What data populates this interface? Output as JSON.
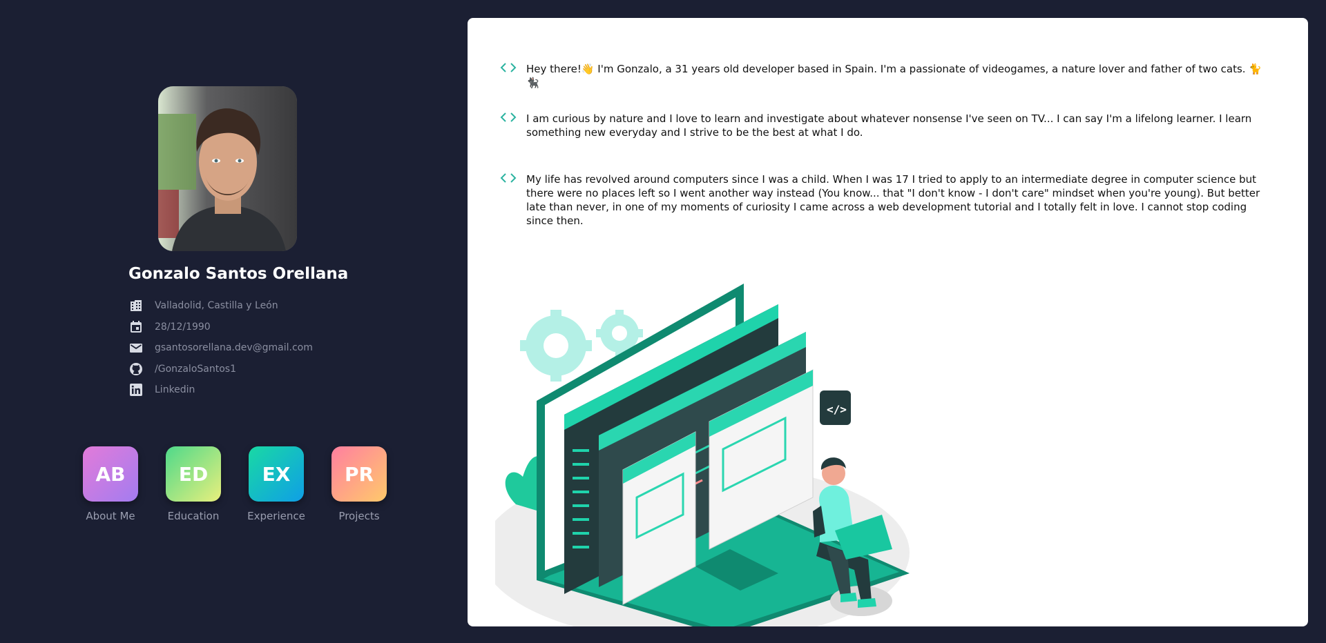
{
  "profile": {
    "name": "Gonzalo Santos Orellana",
    "info": [
      {
        "icon": "building-icon",
        "text": "Valladolid, Castilla y León"
      },
      {
        "icon": "calendar-icon",
        "text": "28/12/1990"
      },
      {
        "icon": "mail-icon",
        "text": "gsantosorellana.dev@gmail.com"
      },
      {
        "icon": "github-icon",
        "text": "/GonzaloSantos1"
      },
      {
        "icon": "linkedin-icon",
        "text": "Linkedin"
      }
    ]
  },
  "nav": [
    {
      "abbr": "AB",
      "label": "About Me",
      "gradient": [
        "#e27bd9",
        "#a37cf0"
      ]
    },
    {
      "abbr": "ED",
      "label": "Education",
      "gradient": [
        "#4fd98a",
        "#e8ef7d"
      ]
    },
    {
      "abbr": "EX",
      "label": "Experience",
      "gradient": [
        "#19d9a4",
        "#0f9fe6"
      ]
    },
    {
      "abbr": "PR",
      "label": "Projects",
      "gradient": [
        "#ff7fa0",
        "#ffc96b"
      ]
    }
  ],
  "about": {
    "paragraphs": [
      "Hey there!👋 I'm Gonzalo, a 31 years old developer based in Spain. I'm a passionate of videogames, a nature lover and father of two cats. 🐈🐈‍⬛",
      "I am curious by nature and I love to learn and investigate about whatever nonsense I've seen on TV... I can say I'm a lifelong learner. I learn something new everyday and I strive to be the best at what I do.",
      "My life has revolved around computers since I was a child. When I was 17 I tried to apply to an intermediate degree in computer science but there were no places left so I went another way instead (You know... that \"I don't know - I don't care\" mindset when you're young). But better late than never, in one of my moments of curiosity I came across a web development tutorial and I totally felt in love. I cannot stop coding since then."
    ]
  },
  "colors": {
    "background": "#1b1f33",
    "accent": "#2bb3a0",
    "panel": "#ffffff"
  }
}
